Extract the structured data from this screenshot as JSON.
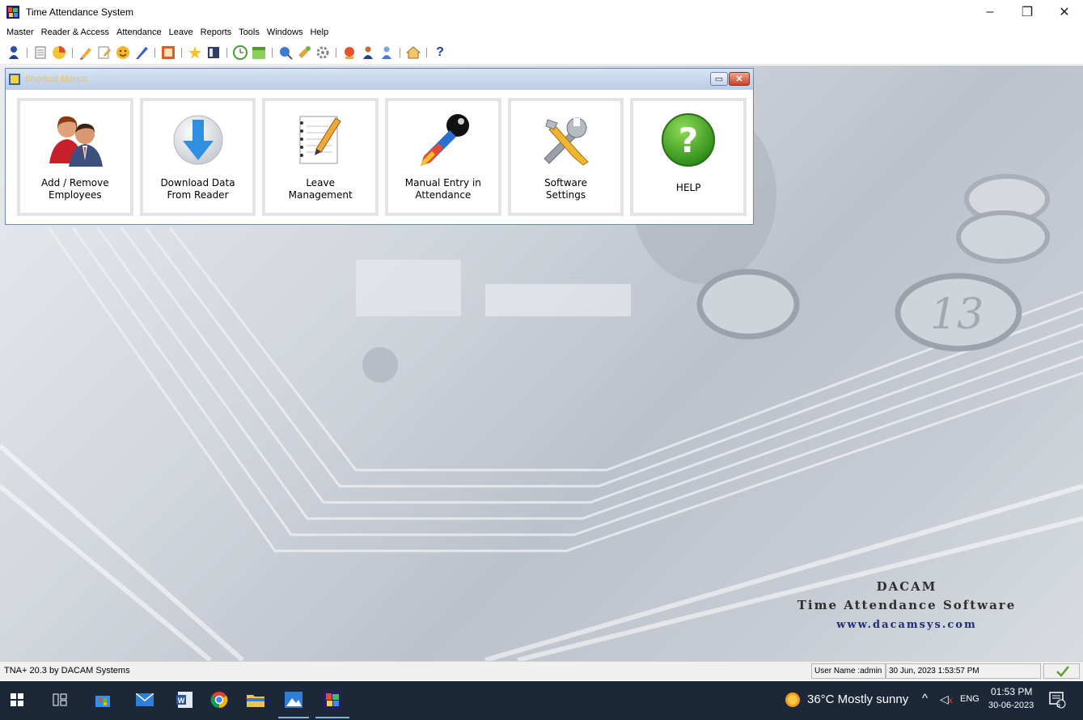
{
  "window": {
    "title": "Time Attendance System",
    "controls": {
      "minimize": "–",
      "maximize": "❐",
      "close": "✕"
    }
  },
  "menubar": {
    "items": [
      "Master",
      "Reader & Access",
      "Attendance",
      "Leave",
      "Reports",
      "Tools",
      "Windows",
      "Help"
    ]
  },
  "toolbar": {
    "icons": [
      "user-icon",
      "document-icon",
      "pie-chart-icon",
      "pencil-icon",
      "edit-icon",
      "smiley-icon",
      "quill-icon",
      "photo-icon",
      "star-icon",
      "book-icon",
      "clock-icon",
      "calendar-icon",
      "globe-search-icon",
      "paint-icon",
      "gear-icon",
      "report-icon",
      "users-icon",
      "user-blue-icon",
      "home-icon",
      "help-icon"
    ]
  },
  "shortcut_menu": {
    "title": "Shortcut Menus",
    "tiles": [
      {
        "line1": "Add / Remove",
        "line2": "Employees",
        "icon": "employees-icon"
      },
      {
        "line1": "Download Data",
        "line2": "From Reader",
        "icon": "download-icon"
      },
      {
        "line1": "Leave",
        "line2": "Management",
        "icon": "leave-notepad-icon"
      },
      {
        "line1": "Manual Entry in",
        "line2": "Attendance",
        "icon": "pen-nib-icon"
      },
      {
        "line1": "Software",
        "line2": "Settings",
        "icon": "tools-icon"
      },
      {
        "line1": "HELP",
        "line2": "",
        "icon": "help-icon"
      }
    ]
  },
  "branding": {
    "line1": "DACAM",
    "line2": "Time Attendance Software",
    "line3": "www.dacamsys.com"
  },
  "statusbar": {
    "left": "TNA+ 20.3 by DACAM Systems",
    "user": "User Name :admin",
    "datetime": "30 Jun, 2023 1:53:57 PM",
    "status_icon": "checkmark-icon"
  },
  "taskbar": {
    "weather": "36°C  Mostly sunny",
    "language": "ENG",
    "time": "01:53 PM",
    "date": "30-06-2023",
    "notifications": "5"
  },
  "colors": {
    "taskbar_bg": "#1c2738",
    "shortcut_title_bg": "#c6d6ec",
    "shortcut_title_text": "#f2c14e",
    "brand_url": "#1e2f78"
  }
}
